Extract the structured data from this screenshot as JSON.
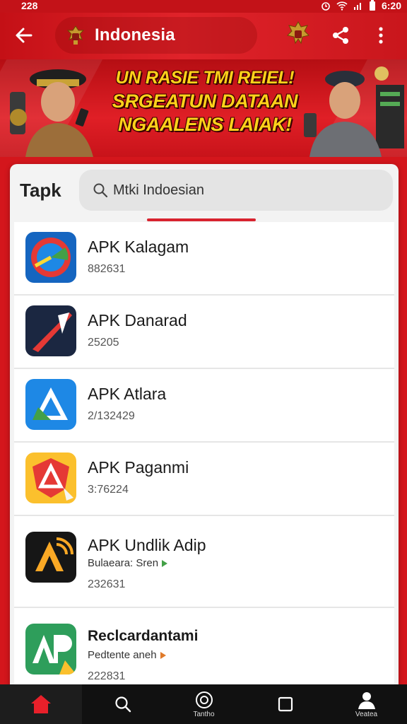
{
  "status_bar": {
    "left_text": "228",
    "time": "6:20"
  },
  "app_bar": {
    "title": "Indonesia"
  },
  "banner": {
    "lines": [
      "UN RASIE TMI REIEL!",
      "SRGEATUN DATAAN",
      "NGAALENS LAIAK!"
    ]
  },
  "section": {
    "label": "Tapk"
  },
  "search": {
    "placeholder": "Mtki Indoesian"
  },
  "apps": [
    {
      "name": "APK Kalagam",
      "meta": "882631",
      "icon": "red-blue-dial-app-icon"
    },
    {
      "name": "APK Danarad",
      "meta": "25205",
      "icon": "red-slash-app-icon"
    },
    {
      "name": "APK Atlara",
      "meta": "2/132429",
      "icon": "blue-triangle-app-icon"
    },
    {
      "name": "APK Paganmi",
      "meta": "3:76224",
      "icon": "red-shield-app-icon"
    },
    {
      "name": "APK Undlik Adip",
      "sub": "Bulaeara: Sren",
      "meta": "232631",
      "icon": "black-gold-a-app-icon"
    },
    {
      "name": "Reclcardantami",
      "sub": "Pedtente aneh",
      "meta": "222831",
      "icon": "green-ap-app-icon"
    }
  ],
  "bottom_nav": [
    {
      "label": "",
      "icon": "home-icon"
    },
    {
      "label": "",
      "icon": "search-icon"
    },
    {
      "label": "Tantho",
      "icon": "circle-icon"
    },
    {
      "label": "",
      "icon": "square-icon"
    },
    {
      "label": "Veatea",
      "icon": "person-icon"
    }
  ],
  "colors": {
    "primary_red": "#d4161c",
    "banner_text": "#ffd21a",
    "tab_indicator": "#d8232f"
  }
}
